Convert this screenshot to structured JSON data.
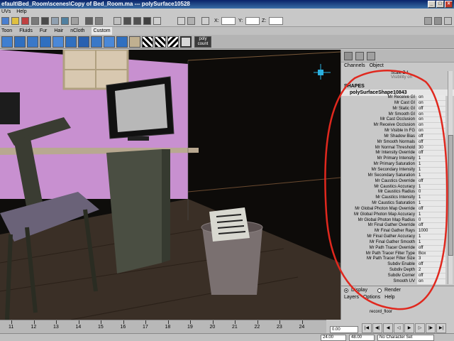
{
  "title": "efault\\Bed_Room\\scenes\\Copy of Bed_Room.ma  ---  polySurface10528",
  "menus": [
    "UVs",
    "Help"
  ],
  "status": {
    "x_label": "X:",
    "y_label": "Y:",
    "z_label": "Z:"
  },
  "shelf_tabs": [
    "Toon",
    "Fluids",
    "Fur",
    "Hair",
    "nCloth",
    "Custom"
  ],
  "shelf": {
    "count_label": "count",
    "poly_label": "poly"
  },
  "channel_box": {
    "menus": [
      "Channels",
      "Object"
    ],
    "scale_row": "Scale Z  1",
    "visibility_row": "Visibility  on",
    "shapes_heading": "SHAPES",
    "shape_name": "polySurfaceShape10843",
    "attributes": [
      {
        "name": "Mr Receive GI",
        "value": "on"
      },
      {
        "name": "Mr Cast GI",
        "value": "on"
      },
      {
        "name": "Mr Static GI",
        "value": "off"
      },
      {
        "name": "Mr Smooth GI",
        "value": "on"
      },
      {
        "name": "Mr Cast Occlusion",
        "value": "on"
      },
      {
        "name": "Mr Receive Occlusion",
        "value": "on"
      },
      {
        "name": "Mr Visible In FG",
        "value": "on"
      },
      {
        "name": "Mr Shadow Bias",
        "value": "off"
      },
      {
        "name": "Mr Smooth Normals",
        "value": "off"
      },
      {
        "name": "Mr Normal Threshold",
        "value": "30"
      },
      {
        "name": "Mr Intensity Override",
        "value": "off"
      },
      {
        "name": "Mr Primary Intensity",
        "value": "1"
      },
      {
        "name": "Mr Primary Saturation",
        "value": "1"
      },
      {
        "name": "Mr Secondary Intensity",
        "value": "1"
      },
      {
        "name": "Mr Secondary Saturation",
        "value": "1"
      },
      {
        "name": "Mr Caustics Override",
        "value": "off"
      },
      {
        "name": "Mr Caustics Accuracy",
        "value": "1"
      },
      {
        "name": "Mr Caustics Radius",
        "value": "0"
      },
      {
        "name": "Mr Caustics Intensity",
        "value": "1"
      },
      {
        "name": "Mr Caustics Saturation",
        "value": "1"
      },
      {
        "name": "Mr Global Photon Map Override",
        "value": "off"
      },
      {
        "name": "Mr Global Photon Map Accuracy",
        "value": "1"
      },
      {
        "name": "Mr Global Photon Map Radius",
        "value": "0"
      },
      {
        "name": "Mr Final Gather Override",
        "value": "off"
      },
      {
        "name": "Mr Final Gather Rays",
        "value": "1000"
      },
      {
        "name": "Mr Final Gather Accuracy",
        "value": "1"
      },
      {
        "name": "Mr Final Gather Smooth",
        "value": "1"
      },
      {
        "name": "Mr Path Tracer Override",
        "value": "off"
      },
      {
        "name": "Mr Path Tracer Filter Type",
        "value": "Box"
      },
      {
        "name": "Mr Path Tracer Filter Size",
        "value": "3"
      },
      {
        "name": "Subdiv Enable",
        "value": "off"
      },
      {
        "name": "Subdiv Depth",
        "value": "2"
      },
      {
        "name": "Subdiv Corner",
        "value": "off"
      },
      {
        "name": "Smooth UV",
        "value": "on"
      }
    ]
  },
  "layer_panel": {
    "display_label": "Display",
    "render_label": "Render",
    "menus": [
      "Layers",
      "Options",
      "Help"
    ],
    "layer_name": "record_floor"
  },
  "timeline": {
    "ticks": [
      "11",
      "12",
      "13",
      "14",
      "15",
      "16",
      "17",
      "18",
      "19",
      "20",
      "21",
      "22",
      "23",
      "24"
    ],
    "current_frame": "0.00",
    "range_start": "24.00",
    "range_end": "48.00",
    "character_set": "No Character Set"
  },
  "colors": {
    "annotation_circle": "#e0281e",
    "wall": "#c890d0",
    "desk": "#a89a8a",
    "floor": "#3a2f26",
    "viewport_bg": "#0e0d0b"
  }
}
